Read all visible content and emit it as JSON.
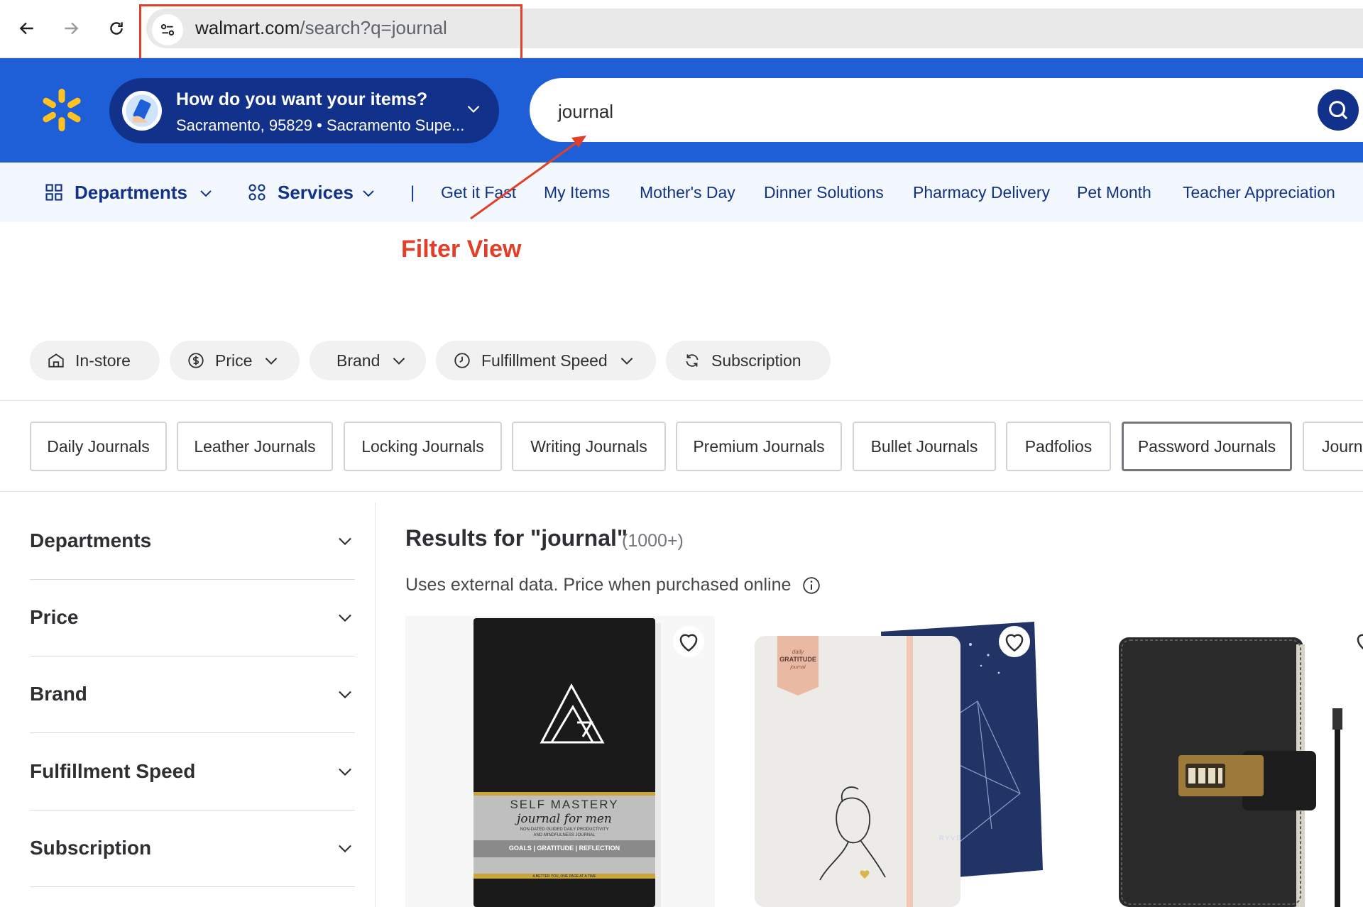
{
  "browser": {
    "url_host": "walmart.com",
    "url_rest": "/search?q=journal"
  },
  "header": {
    "location_title": "How do you want your items?",
    "location_sub": "Sacramento, 95829 • Sacramento Supe...",
    "search_value": "journal"
  },
  "subnav": {
    "departments": "Departments",
    "services": "Services",
    "separator": "|",
    "links": [
      "Get it Fast",
      "My Items",
      "Mother's Day",
      "Dinner Solutions",
      "Pharmacy Delivery",
      "Pet Month",
      "Teacher Appreciation"
    ]
  },
  "annotation": {
    "label": "Filter View"
  },
  "filter_pills": [
    "In-store",
    "Price",
    "Brand",
    "Fulfillment Speed",
    "Subscription"
  ],
  "category_chips": [
    "Daily Journals",
    "Leather Journals",
    "Locking Journals",
    "Writing Journals",
    "Premium Journals",
    "Bullet Journals",
    "Padfolios",
    "Password Journals",
    "Journ"
  ],
  "sidebar": [
    "Departments",
    "Price",
    "Brand",
    "Fulfillment Speed",
    "Subscription"
  ],
  "results": {
    "title": "Results for \"journal\"",
    "count": "(1000+)",
    "note": "Uses external data. Price when purchased online"
  },
  "products": {
    "p1": {
      "line1": "SELF MASTERY",
      "line2": "journal for men",
      "line3": "NON-DATED GUIDED DAILY PRODUCTIVITY",
      "line4": "AND MINDFULNESS JOURNAL",
      "line5": "GOALS | GRATITUDE | REFLECTION",
      "line6": "A BETTER YOU, ONE PAGE AT A TIME"
    },
    "p2": {
      "tag1": "daily",
      "tag2": "GRATITUDE",
      "tag3": "journal",
      "brand": "RYVE"
    }
  },
  "colors": {
    "walmart_blue": "#1e5fd8",
    "dark_blue": "#12318a",
    "spark_yellow": "#ffc220",
    "annotation_red": "#e0402a"
  }
}
